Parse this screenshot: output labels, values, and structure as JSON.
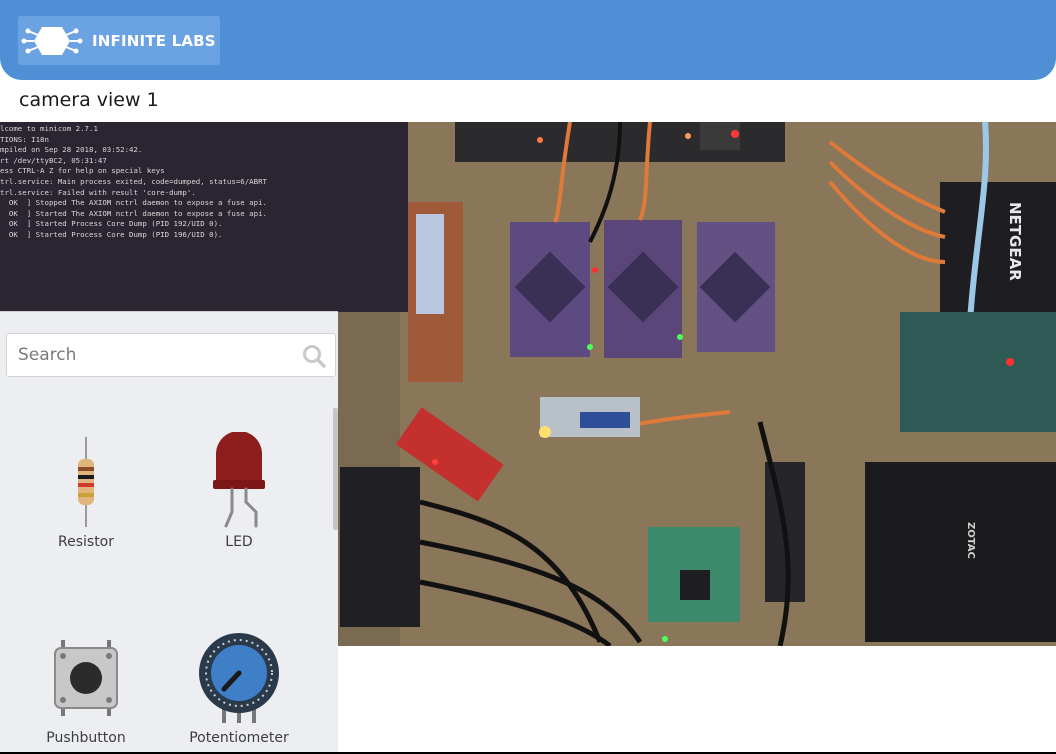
{
  "header": {
    "brand_name": "INFINITE LABS",
    "logo_icon": "hexagon-circuit-logo",
    "colors": {
      "header_bg": "#4f8fd6",
      "logo_bg": "#6aa2e2"
    }
  },
  "camera_section": {
    "title": "camera view 1"
  },
  "terminal": {
    "lines": [
      "lcome to minicom 2.7.1",
      "",
      "TIONS: I18n",
      "mpiled on Sep 28 2018, 03:52:42.",
      "rt /dev/ttyBC2, 05:31:47",
      "",
      "ess CTRL-A Z for help on special keys",
      "",
      "trl.service: Main process exited, code=dumped, status=6/ABRT",
      "trl.service: Failed with result 'core-dump'.",
      "  OK  ] Stopped The AXIOM nctrl daemon to expose a fuse api.",
      "  OK  ] Started The AXIOM nctrl daemon to expose a fuse api.",
      "  OK  ] Started Process Core Dump (PID 192/UID 0).",
      "  OK  ] Started Process Core Dump (PID 196/UID 0)."
    ]
  },
  "component_panel": {
    "search": {
      "placeholder": "Search",
      "value": ""
    },
    "components": [
      {
        "label": "Resistor",
        "icon": "resistor-icon"
      },
      {
        "label": "LED",
        "icon": "led-icon"
      },
      {
        "label": "Pushbutton",
        "icon": "pushbutton-icon"
      },
      {
        "label": "Potentiometer",
        "icon": "potentiometer-icon"
      }
    ]
  }
}
